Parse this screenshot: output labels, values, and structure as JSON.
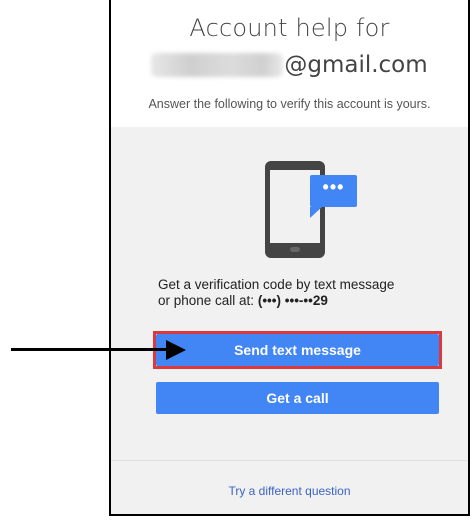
{
  "header": {
    "title": "Account help for",
    "email_domain": "@gmail.com",
    "subtitle": "Answer the following to verify this account is yours."
  },
  "card": {
    "bubble_text": "•••",
    "description_line1": "Get a verification code by text message",
    "description_line2_prefix": "or phone call at: ",
    "phone_number": "(•••) •••-••29",
    "send_button_label": "Send text message",
    "call_button_label": "Get a call",
    "alternate_link": "Try a different question"
  },
  "colors": {
    "accent": "#4285f4",
    "highlight": "#d9393f",
    "card_bg": "#f1f1f1"
  },
  "icons": {
    "phone": "smartphone-icon",
    "bubble": "chat-bubble-icon",
    "arrow": "pointer-arrow-icon"
  }
}
